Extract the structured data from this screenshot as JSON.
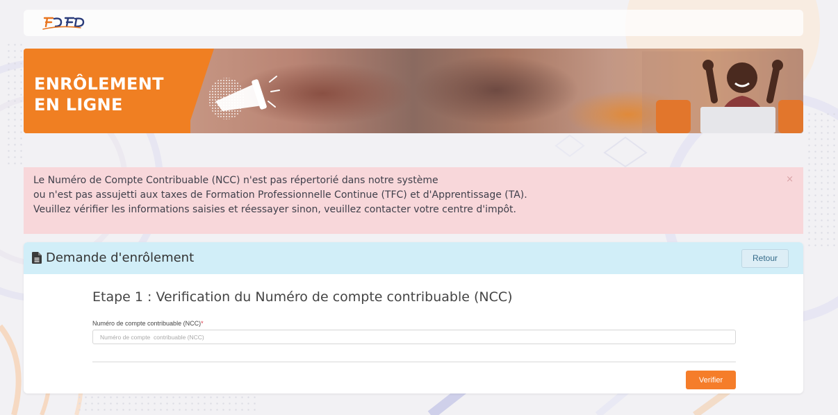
{
  "logo": {
    "icon": "fdfp-logo"
  },
  "banner": {
    "title_line1": "ENRÔLEMENT",
    "title_line2": "EN LIGNE",
    "icon": "megaphone-icon",
    "accent_color": "#f07f22"
  },
  "alert": {
    "line1": "Le Numéro de Compte Contribuable (NCC) n'est pas répertorié dans notre système",
    "line2": "ou n'est pas assujetti aux taxes de Formation Professionnelle Continue (TFC) et d'Apprentissage (TA).",
    "line3": "Veuillez vérifier les informations saisies et réessayer sinon, veuillez contacter votre centre d'impôt.",
    "close": "×"
  },
  "card": {
    "title": "Demande d'enrôlement",
    "back_label": "Retour",
    "step_title": "Etape 1 : Verification du Numéro de compte contribuable (NCC)",
    "field_label": "Numéro de compte contribuable (NCC)",
    "required_mark": "*",
    "field_placeholder": "Numéro de compte  contribuable (NCC)",
    "field_value": "",
    "submit_label": "Verifier"
  },
  "colors": {
    "alert_bg": "#f8d7da",
    "card_header_bg": "#d1eef8",
    "primary_button": "#f57d2a"
  }
}
